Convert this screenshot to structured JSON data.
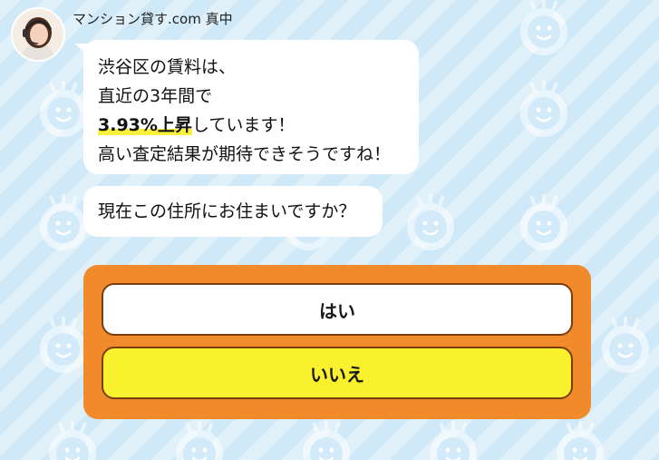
{
  "chat": {
    "sender_name": "マンション貸す.com 真中",
    "message1": {
      "line1": "渋谷区の賃料は、",
      "line2": "直近の3年間で",
      "highlight": "3.93%上昇",
      "line3_rest": "しています！",
      "line4": "高い査定結果が期待できそうですね！"
    },
    "message2": "現在この住所にお住まいですか？"
  },
  "answers": {
    "yes_label": "はい",
    "no_label": "いいえ"
  },
  "colors": {
    "background": "#cfe9f8",
    "panel": "#f08a2a",
    "yes_button": "#ffffff",
    "no_button": "#f9f12e",
    "highlight": "#f8f03a"
  },
  "icons": {
    "avatar": "operator-avatar-icon",
    "background_mascot": "smiley-mascot-icon"
  }
}
